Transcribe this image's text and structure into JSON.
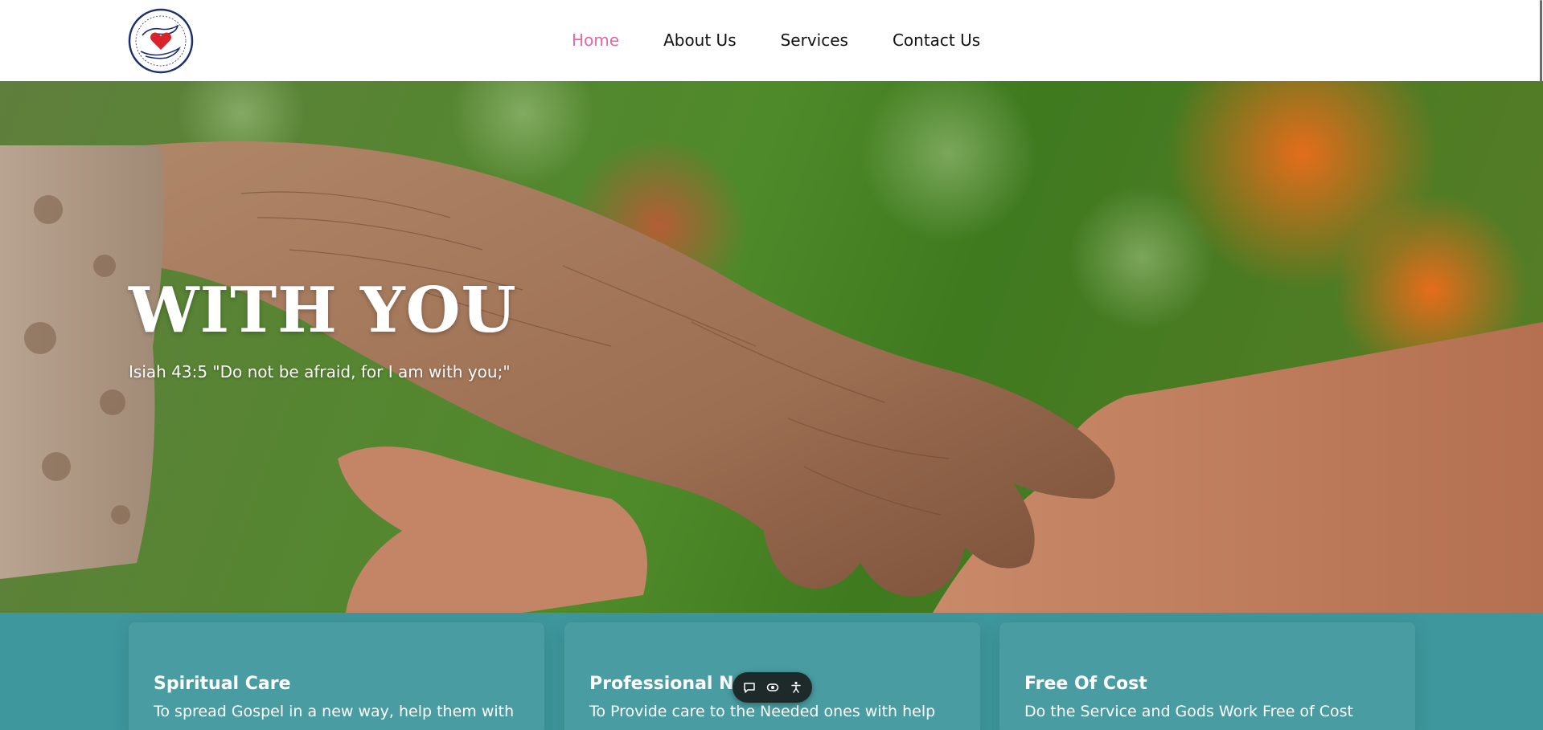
{
  "header": {
    "logo_icon": "hands-holding-heart-logo",
    "nav": [
      {
        "label": "Home",
        "active": true
      },
      {
        "label": "About Us",
        "active": false
      },
      {
        "label": "Services",
        "active": false
      },
      {
        "label": "Contact Us",
        "active": false
      }
    ]
  },
  "hero": {
    "title": "WITH YOU",
    "quote": "Isiah 43:5 \"Do not be afraid, for I am with you;\""
  },
  "features": [
    {
      "title": "Spiritual Care",
      "text": "To spread Gospel in a new way, help them with"
    },
    {
      "title": "Professional Nur",
      "text": "To Provide care to the Needed ones with help"
    },
    {
      "title": "Free Of Cost",
      "text": "Do the Service and Gods Work Free of Cost"
    }
  ],
  "widget": {
    "icons": [
      "chat-icon",
      "view-icon",
      "accessibility-icon"
    ]
  },
  "colors": {
    "nav_active": "#e26aa8",
    "features_bg": "#3e979d",
    "widget_bg": "#1e2a2a"
  }
}
